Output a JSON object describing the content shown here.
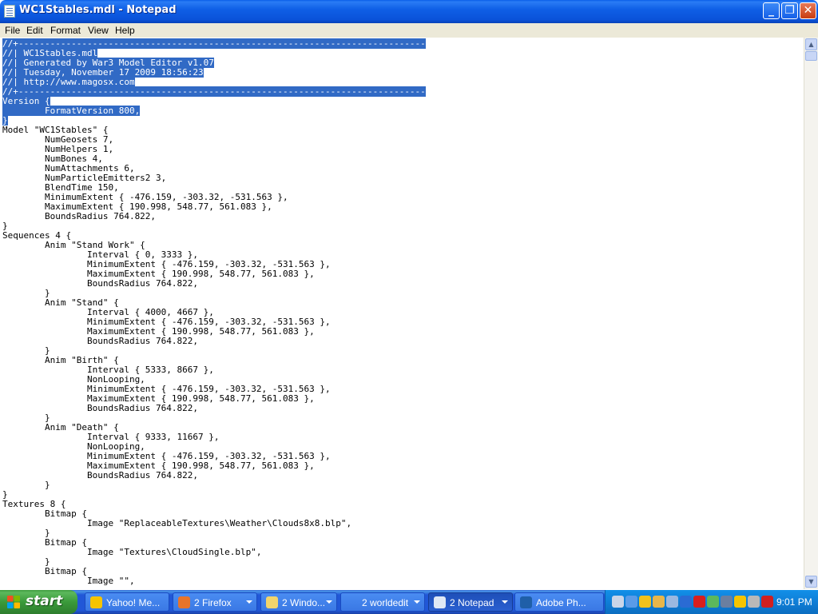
{
  "window": {
    "title": "WC1Stables.mdl - Notepad",
    "min_glyph": "_",
    "max_glyph": "❐",
    "close_glyph": "✕"
  },
  "menu": [
    {
      "label": "File"
    },
    {
      "label": "Edit"
    },
    {
      "label": "Format"
    },
    {
      "label": "View"
    },
    {
      "label": "Help"
    }
  ],
  "editor": {
    "lines": [
      {
        "text": "//+-----------------------------------------------------------------------------",
        "selected": true
      },
      {
        "text": "//| WC1Stables.mdl",
        "selected": true
      },
      {
        "text": "//| Generated by War3 Model Editor v1.07",
        "selected": true
      },
      {
        "text": "//| Tuesday, November 17 2009 18:56:23",
        "selected": true
      },
      {
        "text": "//| http://www.magosx.com",
        "selected": true
      },
      {
        "text": "//+-----------------------------------------------------------------------------",
        "selected": true
      },
      {
        "text": "Version {",
        "selected": true
      },
      {
        "text": "        FormatVersion 800,",
        "selected": true
      },
      {
        "text": "}",
        "selected": true
      },
      {
        "text": "Model \"WC1Stables\" {",
        "selected": false
      },
      {
        "text": "        NumGeosets 7,",
        "selected": false
      },
      {
        "text": "        NumHelpers 1,",
        "selected": false
      },
      {
        "text": "        NumBones 4,",
        "selected": false
      },
      {
        "text": "        NumAttachments 6,",
        "selected": false
      },
      {
        "text": "        NumParticleEmitters2 3,",
        "selected": false
      },
      {
        "text": "        BlendTime 150,",
        "selected": false
      },
      {
        "text": "        MinimumExtent { -476.159, -303.32, -531.563 },",
        "selected": false
      },
      {
        "text": "        MaximumExtent { 190.998, 548.77, 561.083 },",
        "selected": false
      },
      {
        "text": "        BoundsRadius 764.822,",
        "selected": false
      },
      {
        "text": "}",
        "selected": false
      },
      {
        "text": "Sequences 4 {",
        "selected": false
      },
      {
        "text": "        Anim \"Stand Work\" {",
        "selected": false
      },
      {
        "text": "                Interval { 0, 3333 },",
        "selected": false
      },
      {
        "text": "                MinimumExtent { -476.159, -303.32, -531.563 },",
        "selected": false
      },
      {
        "text": "                MaximumExtent { 190.998, 548.77, 561.083 },",
        "selected": false
      },
      {
        "text": "                BoundsRadius 764.822,",
        "selected": false
      },
      {
        "text": "        }",
        "selected": false
      },
      {
        "text": "        Anim \"Stand\" {",
        "selected": false
      },
      {
        "text": "                Interval { 4000, 4667 },",
        "selected": false
      },
      {
        "text": "                MinimumExtent { -476.159, -303.32, -531.563 },",
        "selected": false
      },
      {
        "text": "                MaximumExtent { 190.998, 548.77, 561.083 },",
        "selected": false
      },
      {
        "text": "                BoundsRadius 764.822,",
        "selected": false
      },
      {
        "text": "        }",
        "selected": false
      },
      {
        "text": "        Anim \"Birth\" {",
        "selected": false
      },
      {
        "text": "                Interval { 5333, 8667 },",
        "selected": false
      },
      {
        "text": "                NonLooping,",
        "selected": false
      },
      {
        "text": "                MinimumExtent { -476.159, -303.32, -531.563 },",
        "selected": false
      },
      {
        "text": "                MaximumExtent { 190.998, 548.77, 561.083 },",
        "selected": false
      },
      {
        "text": "                BoundsRadius 764.822,",
        "selected": false
      },
      {
        "text": "        }",
        "selected": false
      },
      {
        "text": "        Anim \"Death\" {",
        "selected": false
      },
      {
        "text": "                Interval { 9333, 11667 },",
        "selected": false
      },
      {
        "text": "                NonLooping,",
        "selected": false
      },
      {
        "text": "                MinimumExtent { -476.159, -303.32, -531.563 },",
        "selected": false
      },
      {
        "text": "                MaximumExtent { 190.998, 548.77, 561.083 },",
        "selected": false
      },
      {
        "text": "                BoundsRadius 764.822,",
        "selected": false
      },
      {
        "text": "        }",
        "selected": false
      },
      {
        "text": "}",
        "selected": false
      },
      {
        "text": "Textures 8 {",
        "selected": false
      },
      {
        "text": "        Bitmap {",
        "selected": false
      },
      {
        "text": "                Image \"ReplaceableTextures\\Weather\\Clouds8x8.blp\",",
        "selected": false
      },
      {
        "text": "        }",
        "selected": false
      },
      {
        "text": "        Bitmap {",
        "selected": false
      },
      {
        "text": "                Image \"Textures\\CloudSingle.blp\",",
        "selected": false
      },
      {
        "text": "        }",
        "selected": false
      },
      {
        "text": "        Bitmap {",
        "selected": false
      },
      {
        "text": "                Image \"\",",
        "selected": false
      }
    ]
  },
  "scrollbar": {
    "up_glyph": "▲",
    "down_glyph": "▼"
  },
  "taskbar": {
    "start_label": "start",
    "tasks": [
      {
        "label": "Yahoo! Me...",
        "icon": "yahoo-messenger-icon",
        "color": "#f5c400",
        "active": false,
        "group": false
      },
      {
        "label": "2 Firefox",
        "icon": "firefox-icon",
        "color": "#e8742a",
        "active": false,
        "group": true
      },
      {
        "label": "2 Windo...",
        "icon": "folder-icon",
        "color": "#f2d46b",
        "active": false,
        "group": true
      },
      {
        "label": "2 worldedit",
        "icon": "",
        "color": "",
        "active": false,
        "group": true
      },
      {
        "label": "2 Notepad",
        "icon": "notepad-icon",
        "color": "#dfe8f5",
        "active": true,
        "group": true
      },
      {
        "label": "Adobe Ph...",
        "icon": "photoshop-icon",
        "color": "#1f5fa8",
        "active": false,
        "group": false
      }
    ],
    "tray_icons": [
      {
        "icon": "tools-icon",
        "color": "#c9d5e8"
      },
      {
        "icon": "back-arrow-icon",
        "color": "#5a9be8"
      },
      {
        "icon": "security-shield-icon",
        "color": "#f2c21b"
      },
      {
        "icon": "network-icon",
        "color": "#e8b64a"
      },
      {
        "icon": "computer-icon",
        "color": "#9ab8e0"
      },
      {
        "icon": "hp-icon",
        "color": "#2a6bd4"
      },
      {
        "icon": "ati-icon",
        "color": "#d91e1e"
      },
      {
        "icon": "chat-icon",
        "color": "#5cb85c"
      },
      {
        "icon": "tablet-icon",
        "color": "#6a7fa0"
      },
      {
        "icon": "smiley-icon",
        "color": "#f5c400"
      },
      {
        "icon": "media-icon",
        "color": "#b8b8b8"
      },
      {
        "icon": "acrobat-icon",
        "color": "#d02020"
      }
    ],
    "clock": "9:01 PM"
  }
}
